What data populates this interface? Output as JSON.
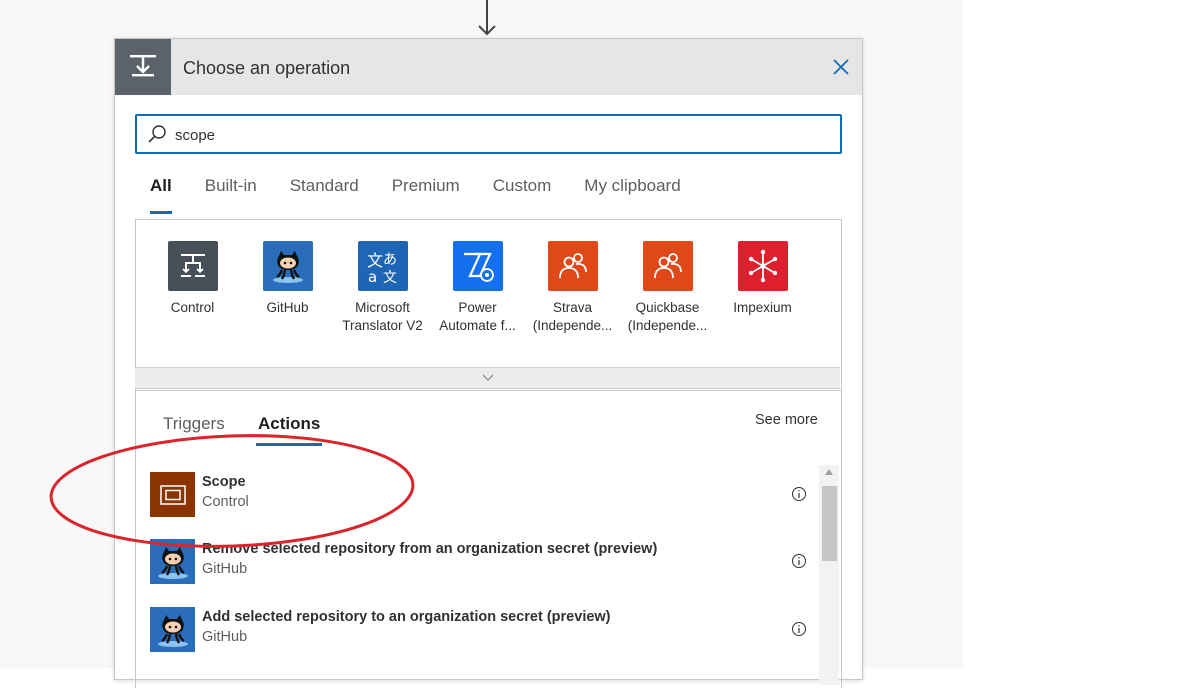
{
  "dialog": {
    "title": "Choose an operation",
    "close_icon": "close-icon",
    "header_icon": "control-icon"
  },
  "search": {
    "value": "scope",
    "icon": "search-icon"
  },
  "tabs": [
    {
      "label": "All",
      "active": true
    },
    {
      "label": "Built-in",
      "active": false
    },
    {
      "label": "Standard",
      "active": false
    },
    {
      "label": "Premium",
      "active": false
    },
    {
      "label": "Custom",
      "active": false
    },
    {
      "label": "My clipboard",
      "active": false
    }
  ],
  "connectors": [
    {
      "line1": "Control",
      "line2": "",
      "icon": "control-icon",
      "color": "#474f58"
    },
    {
      "line1": "GitHub",
      "line2": "",
      "icon": "github-octocat-icon",
      "color": "#2a6ebb"
    },
    {
      "line1": "Microsoft",
      "line2": "Translator V2",
      "icon": "translator-icon",
      "color": "#1f65b5"
    },
    {
      "line1": "Power",
      "line2": "Automate f...",
      "icon": "power-automate-icon",
      "color": "#1570ef"
    },
    {
      "line1": "Strava",
      "line2": "(Independe...",
      "icon": "people-icon",
      "color": "#e04817"
    },
    {
      "line1": "Quickbase",
      "line2": "(Independe...",
      "icon": "people-icon",
      "color": "#e04817"
    },
    {
      "line1": "Impexium",
      "line2": "",
      "icon": "impexium-icon",
      "color": "#de1f2e"
    }
  ],
  "expander_icon": "chevron-down-icon",
  "subtabs": [
    {
      "label": "Triggers",
      "active": false
    },
    {
      "label": "Actions",
      "active": true
    }
  ],
  "see_more": "See more",
  "actions": [
    {
      "title": "Scope",
      "subtitle": "Control",
      "icon": "scope-icon",
      "color": "#8c3400"
    },
    {
      "title": "Remove selected repository from an organization secret (preview)",
      "subtitle": "GitHub",
      "icon": "github-octocat-icon",
      "color": "#2a6ebb"
    },
    {
      "title": "Add selected repository to an organization secret (preview)",
      "subtitle": "GitHub",
      "icon": "github-octocat-icon",
      "color": "#2a6ebb"
    }
  ],
  "annotation": {
    "shape": "ellipse",
    "color": "#d9252b"
  }
}
